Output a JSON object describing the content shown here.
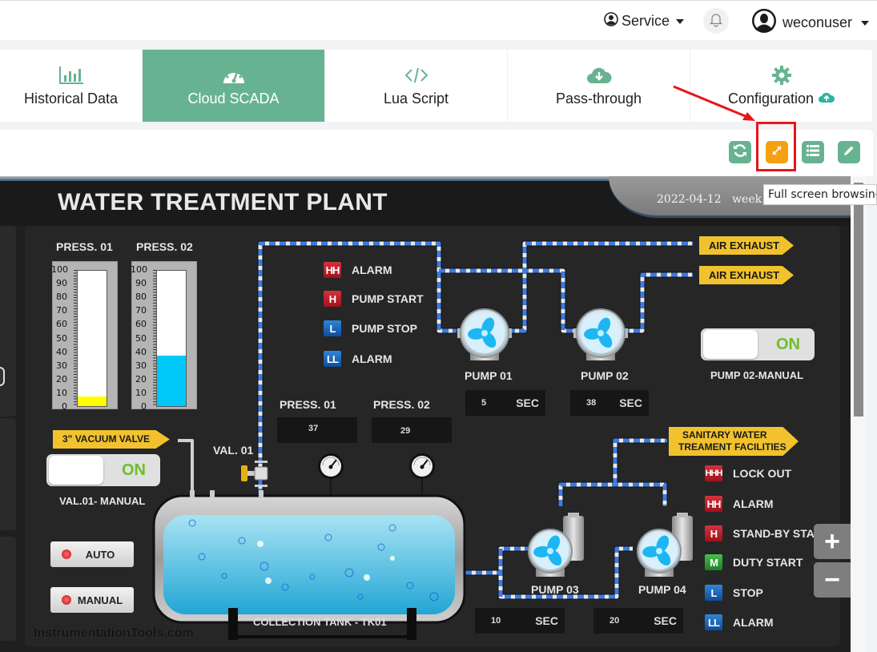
{
  "topbar": {
    "service_label": "Service",
    "notifications_icon": "bell-icon",
    "username": "weconuser"
  },
  "nav": {
    "tabs": [
      {
        "label": "Historical Data",
        "icon": "bar-chart-icon",
        "active": false
      },
      {
        "label": "Cloud SCADA",
        "icon": "dashboard-gauge-icon",
        "active": true
      },
      {
        "label": "Lua Script",
        "icon": "code-icon",
        "active": false
      },
      {
        "label": "Pass-through",
        "icon": "cloud-download-icon",
        "active": false
      },
      {
        "label": "Configuration",
        "icon": "gear-icon",
        "active": false,
        "badge_icon": "cloud-upload-icon"
      }
    ]
  },
  "toolbar": {
    "buttons": [
      {
        "name": "refresh",
        "icon": "refresh-icon",
        "color": "#67b391"
      },
      {
        "name": "fullscreen",
        "icon": "expand-arrows-icon",
        "color": "#f5a011",
        "highlighted": true
      },
      {
        "name": "list",
        "icon": "list-icon",
        "color": "#67b391"
      },
      {
        "name": "edit",
        "icon": "pencil-icon",
        "color": "#67b391"
      }
    ],
    "tooltip": "Full screen browsing"
  },
  "scada": {
    "title": "WATER TREATMENT PLANT",
    "date": "2022-04-12",
    "week": "week. T",
    "bar_gauges": [
      {
        "label": "PRESS. 01",
        "value_percent": 7,
        "fill_color": "#ffff00"
      },
      {
        "label": "PRESS. 02",
        "value_percent": 37,
        "fill_color": "#00c8f8"
      }
    ],
    "gauge_ticks": [
      "100",
      "90",
      "80",
      "70",
      "60",
      "50",
      "40",
      "30",
      "20",
      "10",
      "0"
    ],
    "top_indicators": [
      {
        "code": "HH",
        "label": "ALARM",
        "color": "red"
      },
      {
        "code": "H",
        "label": "PUMP START",
        "color": "red"
      },
      {
        "code": "L",
        "label": "PUMP STOP",
        "color": "blue"
      },
      {
        "code": "LL",
        "label": "ALARM",
        "color": "blue"
      }
    ],
    "bottom_indicators": [
      {
        "code": "HHH",
        "label": "LOCK OUT",
        "color": "red"
      },
      {
        "code": "HH",
        "label": "ALARM",
        "color": "red"
      },
      {
        "code": "H",
        "label": "STAND-BY START",
        "color": "red"
      },
      {
        "code": "M",
        "label": "DUTY START",
        "color": "green"
      },
      {
        "code": "L",
        "label": "STOP",
        "color": "blue"
      },
      {
        "code": "LL",
        "label": "ALARM",
        "color": "blue"
      }
    ],
    "tags": {
      "air_exhaust_1": "AIR EXHAUST",
      "air_exhaust_2": "AIR EXHAUST",
      "vacuum_valve": "3\" VACUUM VALVE",
      "sanitary_line1": "SANITARY WATER",
      "sanitary_line2": "TREAMENT FACILITIES"
    },
    "pumps": [
      {
        "label": "PUMP 01",
        "timer": "5",
        "unit": "SEC"
      },
      {
        "label": "PUMP 02",
        "timer": "38",
        "unit": "SEC"
      },
      {
        "label": "PUMP 03",
        "timer": "10",
        "unit": "SEC"
      },
      {
        "label": "PUMP 04",
        "timer": "20",
        "unit": "SEC"
      }
    ],
    "pressure_readouts": [
      {
        "label": "PRESS. 01",
        "value": "37"
      },
      {
        "label": "PRESS. 02",
        "value": "29"
      }
    ],
    "pump02_manual": {
      "label": "PUMP 02-MANUAL",
      "state": "ON"
    },
    "val01_manual": {
      "label": "VAL.01- MANUAL",
      "state": "ON"
    },
    "valve_label": "VAL. 01",
    "mode_buttons": [
      "AUTO",
      "MANUAL"
    ],
    "tank_label": "COLLECTION TANK - TK01",
    "zoom_in": "+",
    "zoom_out": "−",
    "watermark": "InstrumentationTools.com"
  }
}
